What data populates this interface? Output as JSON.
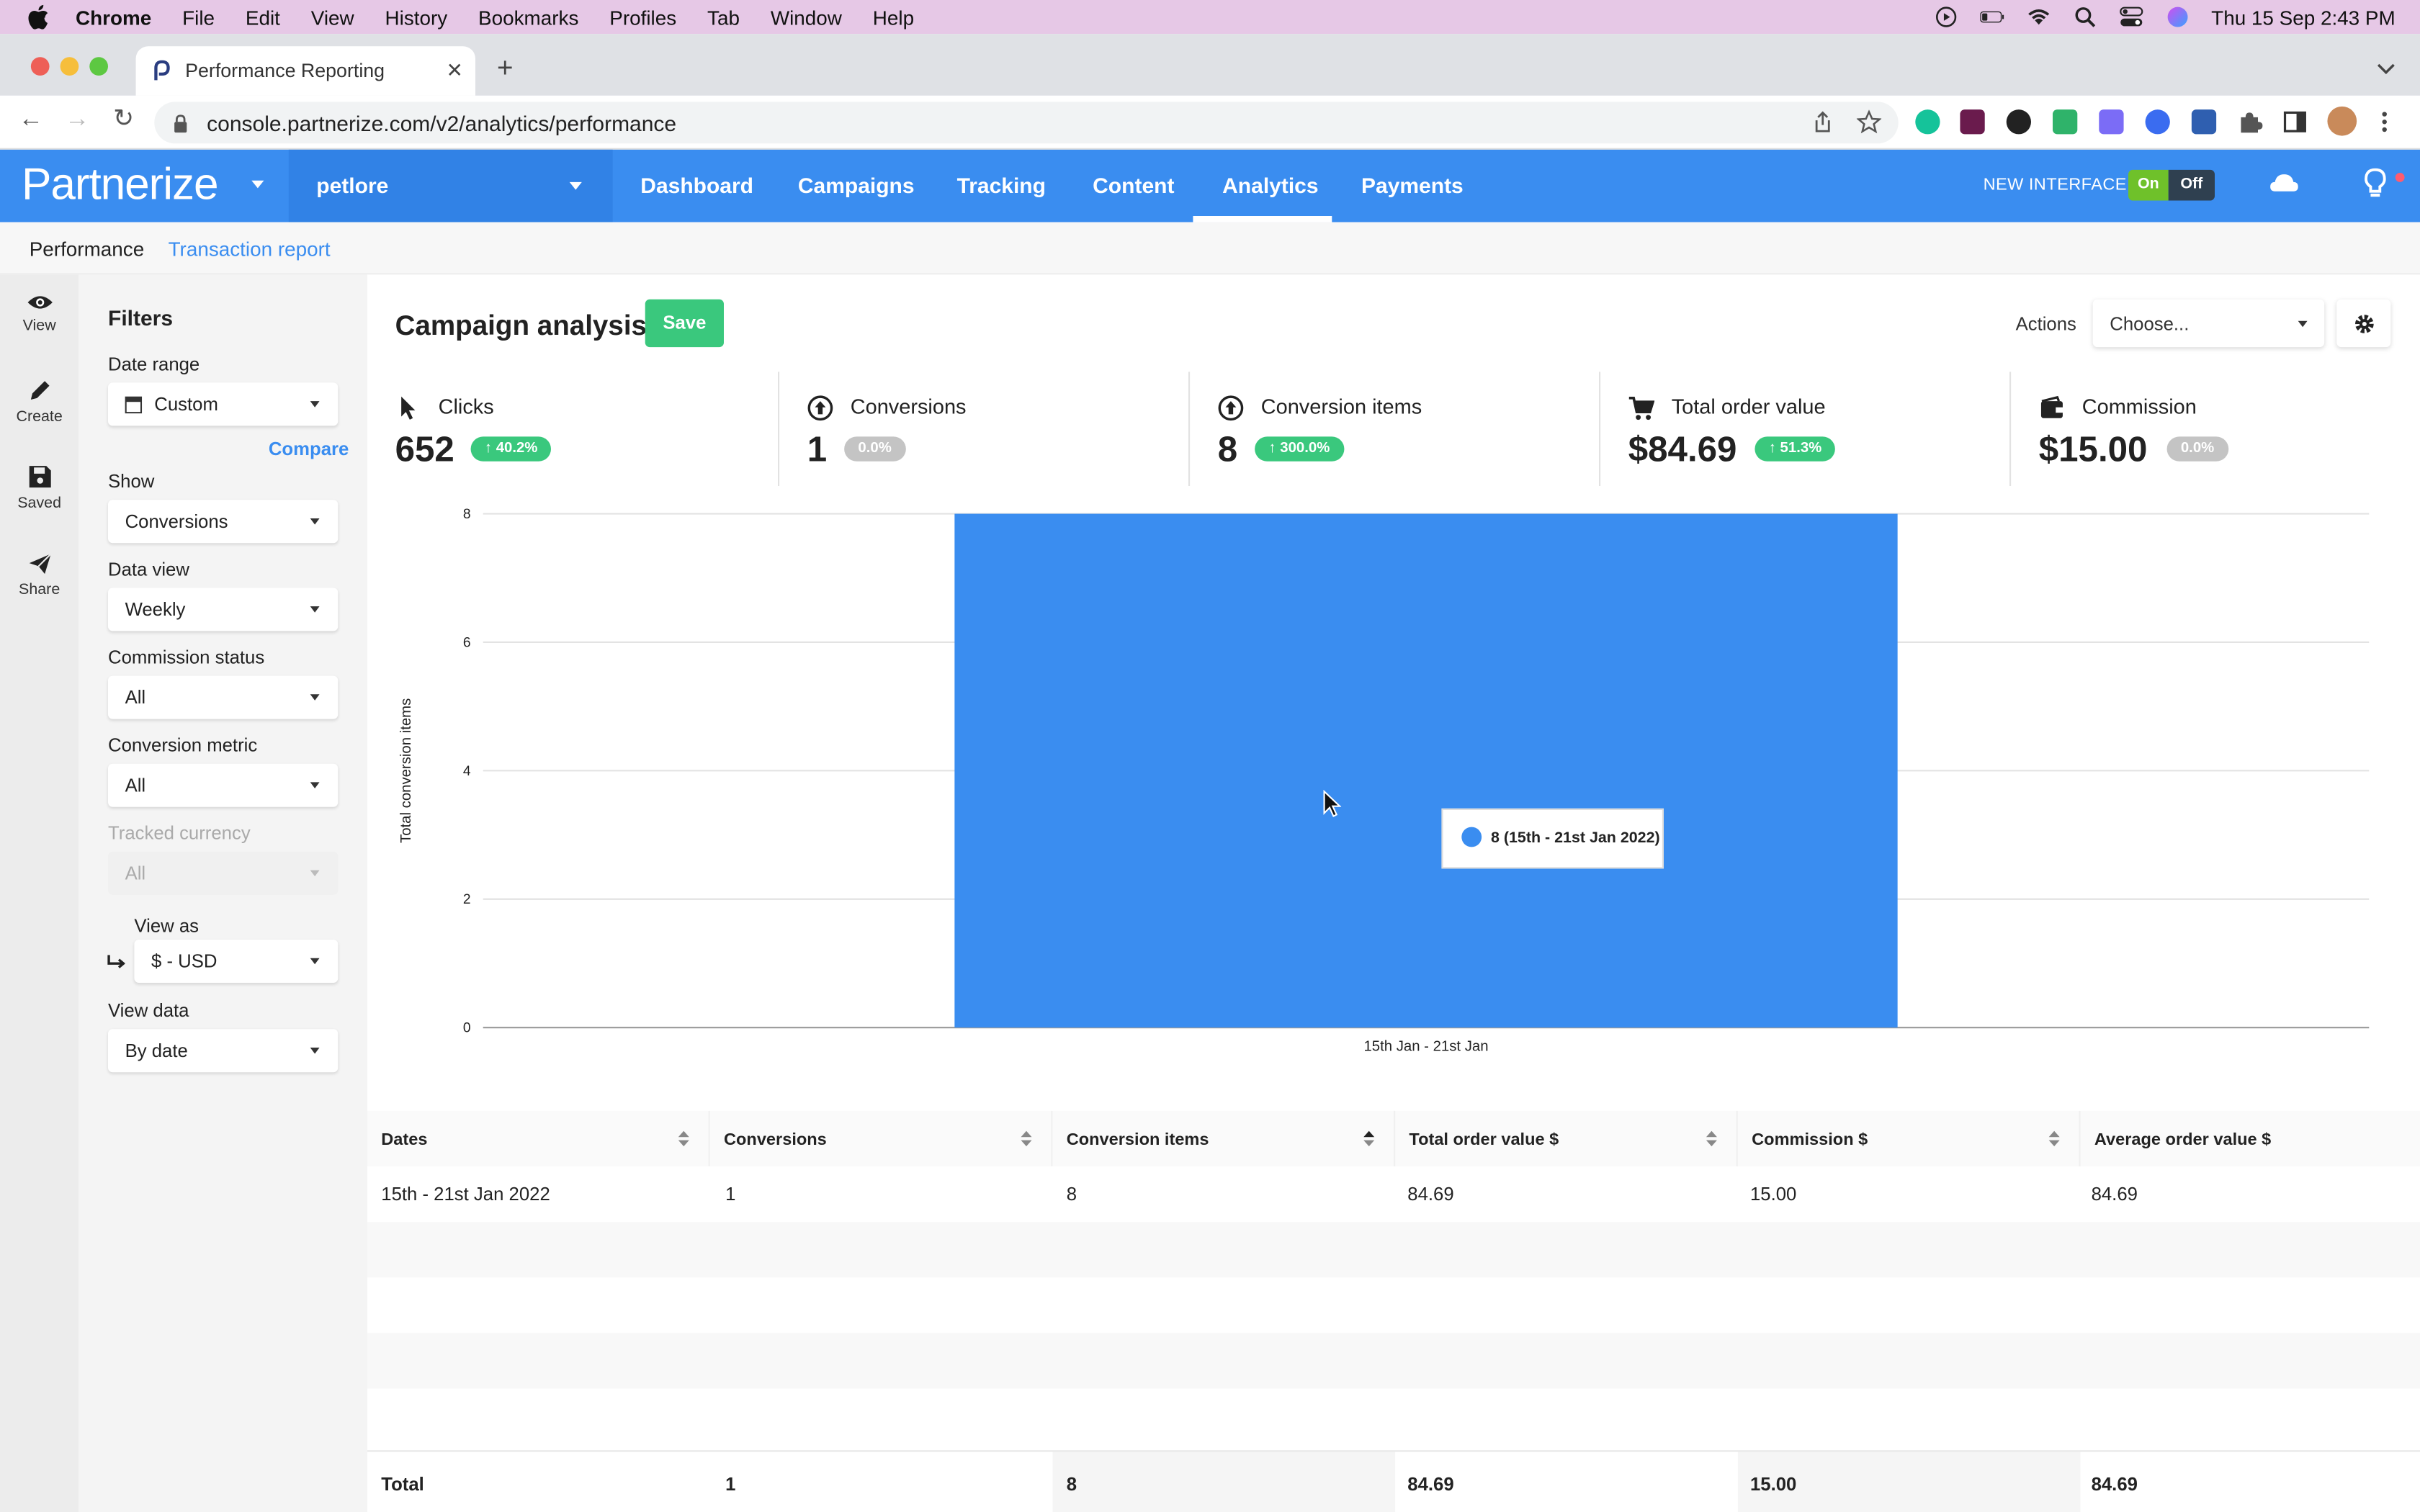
{
  "menubar": {
    "app": "Chrome",
    "menus": [
      "File",
      "Edit",
      "View",
      "History",
      "Bookmarks",
      "Profiles",
      "Tab",
      "Window",
      "Help"
    ],
    "clock": "Thu 15 Sep  2:43 PM"
  },
  "browser": {
    "tab_title": "Performance Reporting",
    "url": "console.partnerize.com/v2/analytics/performance"
  },
  "app": {
    "brand": "Partnerize",
    "account": "petlore",
    "nav": [
      "Dashboard",
      "Campaigns",
      "Tracking",
      "Content",
      "Analytics",
      "Payments"
    ],
    "active_nav": "Analytics",
    "new_interface_label": "NEW INTERFACE",
    "toggle_on": "On",
    "toggle_off": "Off",
    "accent": "#3a8df0",
    "success": "#3ac87d"
  },
  "subnav": {
    "performance": "Performance",
    "transaction_report": "Transaction report"
  },
  "rail": {
    "view": "View",
    "create": "Create",
    "saved": "Saved",
    "share": "Share"
  },
  "filters": {
    "title": "Filters",
    "date_range_label": "Date range",
    "date_range_value": "Custom",
    "compare": "Compare",
    "show_label": "Show",
    "show_value": "Conversions",
    "data_view_label": "Data view",
    "data_view_value": "Weekly",
    "commission_status_label": "Commission status",
    "commission_status_value": "All",
    "conversion_metric_label": "Conversion metric",
    "conversion_metric_value": "All",
    "tracked_currency_label": "Tracked currency",
    "tracked_currency_value": "All",
    "view_as_label": "View as",
    "view_as_value": "$ - USD",
    "view_data_label": "View data",
    "view_data_value": "By date"
  },
  "main": {
    "title": "Campaign analysis",
    "save": "Save",
    "actions_label": "Actions",
    "actions_value": "Choose..."
  },
  "kpis": [
    {
      "label": "Clicks",
      "value": "652",
      "badge": "↑ 40.2%",
      "icon": "cursor-icon",
      "trend": "up"
    },
    {
      "label": "Conversions",
      "value": "1",
      "badge": "0.0%",
      "icon": "conversion-arrow-icon",
      "trend": "neutral"
    },
    {
      "label": "Conversion items",
      "value": "8",
      "badge": "↑ 300.0%",
      "icon": "conversion-items-icon",
      "trend": "up"
    },
    {
      "label": "Total order value",
      "value": "$84.69",
      "badge": "↑ 51.3%",
      "icon": "cart-icon",
      "trend": "up"
    },
    {
      "label": "Commission",
      "value": "$15.00",
      "badge": "0.0%",
      "icon": "wallet-icon",
      "trend": "neutral"
    }
  ],
  "chart_data": {
    "type": "bar",
    "categories": [
      "15th Jan - 21st Jan"
    ],
    "values": [
      8
    ],
    "ylabel": "Total conversion items",
    "xlabel": "",
    "ylim": [
      0,
      8
    ],
    "yticks": [
      0,
      2,
      4,
      6,
      8
    ],
    "color": "#3a8df0",
    "tooltip": "8 (15th - 21st Jan 2022)"
  },
  "table": {
    "headers": [
      "Dates",
      "Conversions",
      "Conversion items",
      "Total order value $",
      "Commission $",
      "Average order value $"
    ],
    "rows": [
      [
        "15th - 21st Jan 2022",
        "1",
        "8",
        "84.69",
        "15.00",
        "84.69"
      ]
    ],
    "totals": [
      "Total",
      "1",
      "8",
      "84.69",
      "15.00",
      "84.69"
    ]
  }
}
